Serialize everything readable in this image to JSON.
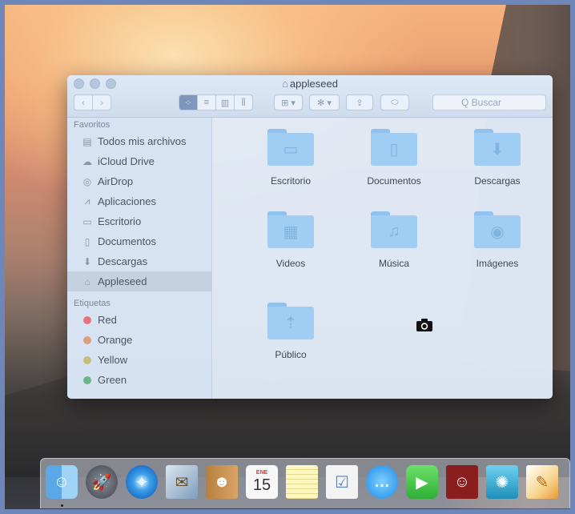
{
  "window": {
    "title": "appleseed",
    "search_placeholder": "Q Buscar"
  },
  "toolbar": {
    "back_icon": "chevron-left-icon",
    "forward_icon": "chevron-right-icon",
    "views": [
      "icon-view",
      "list-view",
      "column-view",
      "cover-flow-view"
    ],
    "active_view": "icon-view"
  },
  "sidebar": {
    "favorites_header": "Favoritos",
    "favorites": [
      {
        "label": "Todos mis archivos",
        "icon": "all-files-icon"
      },
      {
        "label": "iCloud Drive",
        "icon": "cloud-icon"
      },
      {
        "label": "AirDrop",
        "icon": "airdrop-icon"
      },
      {
        "label": "Aplicaciones",
        "icon": "applications-icon"
      },
      {
        "label": "Escritorio",
        "icon": "desktop-icon"
      },
      {
        "label": "Documentos",
        "icon": "document-icon"
      },
      {
        "label": "Descargas",
        "icon": "download-icon"
      },
      {
        "label": "Appleseed",
        "icon": "home-icon",
        "selected": true
      }
    ],
    "tags_header": "Etiquetas",
    "tags": [
      {
        "label": "Red",
        "color": "#e8737d"
      },
      {
        "label": "Orange",
        "color": "#d9a07a"
      },
      {
        "label": "Yellow",
        "color": "#c7bd7c"
      },
      {
        "label": "Green",
        "color": "#69b785"
      }
    ]
  },
  "content": {
    "folders": [
      {
        "label": "Escritorio",
        "icon": "desktop-folder-icon"
      },
      {
        "label": "Documentos",
        "icon": "documents-folder-icon"
      },
      {
        "label": "Descargas",
        "icon": "downloads-folder-icon"
      },
      {
        "label": "Videos",
        "icon": "movies-folder-icon"
      },
      {
        "label": "Música",
        "icon": "music-folder-icon"
      },
      {
        "label": "Imágenes",
        "icon": "pictures-folder-icon"
      },
      {
        "label": "Público",
        "icon": "public-folder-icon"
      }
    ]
  },
  "dock": {
    "calendar_month": "ENE",
    "calendar_day": "15",
    "apps": [
      "Finder",
      "Launchpad",
      "Safari",
      "Mail",
      "Contacts",
      "Calendar",
      "Notes",
      "Reminders",
      "Messages",
      "FaceTime",
      "Photo Booth",
      "iPhoto",
      "Pages"
    ]
  },
  "colors": {
    "folder_blue": "#9fcdf3",
    "selection": "#c6d1e0",
    "accent": "#7f97bd"
  }
}
